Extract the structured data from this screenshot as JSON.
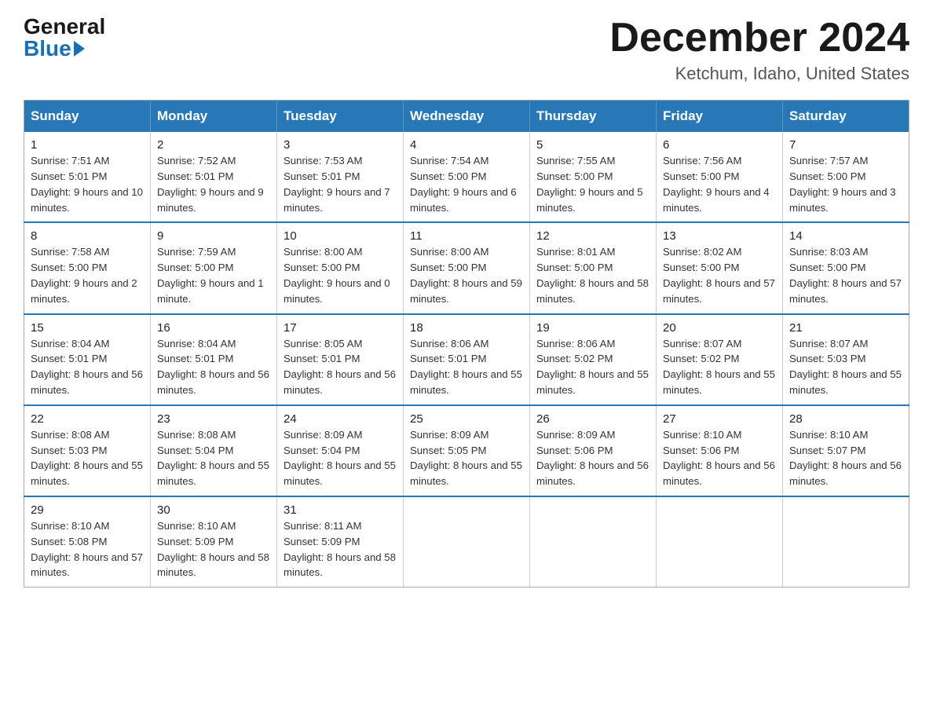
{
  "logo": {
    "general": "General",
    "blue": "Blue"
  },
  "title": "December 2024",
  "subtitle": "Ketchum, Idaho, United States",
  "days_of_week": [
    "Sunday",
    "Monday",
    "Tuesday",
    "Wednesday",
    "Thursday",
    "Friday",
    "Saturday"
  ],
  "weeks": [
    [
      {
        "day": "1",
        "sunrise": "7:51 AM",
        "sunset": "5:01 PM",
        "daylight": "9 hours and 10 minutes."
      },
      {
        "day": "2",
        "sunrise": "7:52 AM",
        "sunset": "5:01 PM",
        "daylight": "9 hours and 9 minutes."
      },
      {
        "day": "3",
        "sunrise": "7:53 AM",
        "sunset": "5:01 PM",
        "daylight": "9 hours and 7 minutes."
      },
      {
        "day": "4",
        "sunrise": "7:54 AM",
        "sunset": "5:00 PM",
        "daylight": "9 hours and 6 minutes."
      },
      {
        "day": "5",
        "sunrise": "7:55 AM",
        "sunset": "5:00 PM",
        "daylight": "9 hours and 5 minutes."
      },
      {
        "day": "6",
        "sunrise": "7:56 AM",
        "sunset": "5:00 PM",
        "daylight": "9 hours and 4 minutes."
      },
      {
        "day": "7",
        "sunrise": "7:57 AM",
        "sunset": "5:00 PM",
        "daylight": "9 hours and 3 minutes."
      }
    ],
    [
      {
        "day": "8",
        "sunrise": "7:58 AM",
        "sunset": "5:00 PM",
        "daylight": "9 hours and 2 minutes."
      },
      {
        "day": "9",
        "sunrise": "7:59 AM",
        "sunset": "5:00 PM",
        "daylight": "9 hours and 1 minute."
      },
      {
        "day": "10",
        "sunrise": "8:00 AM",
        "sunset": "5:00 PM",
        "daylight": "9 hours and 0 minutes."
      },
      {
        "day": "11",
        "sunrise": "8:00 AM",
        "sunset": "5:00 PM",
        "daylight": "8 hours and 59 minutes."
      },
      {
        "day": "12",
        "sunrise": "8:01 AM",
        "sunset": "5:00 PM",
        "daylight": "8 hours and 58 minutes."
      },
      {
        "day": "13",
        "sunrise": "8:02 AM",
        "sunset": "5:00 PM",
        "daylight": "8 hours and 57 minutes."
      },
      {
        "day": "14",
        "sunrise": "8:03 AM",
        "sunset": "5:00 PM",
        "daylight": "8 hours and 57 minutes."
      }
    ],
    [
      {
        "day": "15",
        "sunrise": "8:04 AM",
        "sunset": "5:01 PM",
        "daylight": "8 hours and 56 minutes."
      },
      {
        "day": "16",
        "sunrise": "8:04 AM",
        "sunset": "5:01 PM",
        "daylight": "8 hours and 56 minutes."
      },
      {
        "day": "17",
        "sunrise": "8:05 AM",
        "sunset": "5:01 PM",
        "daylight": "8 hours and 56 minutes."
      },
      {
        "day": "18",
        "sunrise": "8:06 AM",
        "sunset": "5:01 PM",
        "daylight": "8 hours and 55 minutes."
      },
      {
        "day": "19",
        "sunrise": "8:06 AM",
        "sunset": "5:02 PM",
        "daylight": "8 hours and 55 minutes."
      },
      {
        "day": "20",
        "sunrise": "8:07 AM",
        "sunset": "5:02 PM",
        "daylight": "8 hours and 55 minutes."
      },
      {
        "day": "21",
        "sunrise": "8:07 AM",
        "sunset": "5:03 PM",
        "daylight": "8 hours and 55 minutes."
      }
    ],
    [
      {
        "day": "22",
        "sunrise": "8:08 AM",
        "sunset": "5:03 PM",
        "daylight": "8 hours and 55 minutes."
      },
      {
        "day": "23",
        "sunrise": "8:08 AM",
        "sunset": "5:04 PM",
        "daylight": "8 hours and 55 minutes."
      },
      {
        "day": "24",
        "sunrise": "8:09 AM",
        "sunset": "5:04 PM",
        "daylight": "8 hours and 55 minutes."
      },
      {
        "day": "25",
        "sunrise": "8:09 AM",
        "sunset": "5:05 PM",
        "daylight": "8 hours and 55 minutes."
      },
      {
        "day": "26",
        "sunrise": "8:09 AM",
        "sunset": "5:06 PM",
        "daylight": "8 hours and 56 minutes."
      },
      {
        "day": "27",
        "sunrise": "8:10 AM",
        "sunset": "5:06 PM",
        "daylight": "8 hours and 56 minutes."
      },
      {
        "day": "28",
        "sunrise": "8:10 AM",
        "sunset": "5:07 PM",
        "daylight": "8 hours and 56 minutes."
      }
    ],
    [
      {
        "day": "29",
        "sunrise": "8:10 AM",
        "sunset": "5:08 PM",
        "daylight": "8 hours and 57 minutes."
      },
      {
        "day": "30",
        "sunrise": "8:10 AM",
        "sunset": "5:09 PM",
        "daylight": "8 hours and 58 minutes."
      },
      {
        "day": "31",
        "sunrise": "8:11 AM",
        "sunset": "5:09 PM",
        "daylight": "8 hours and 58 minutes."
      },
      null,
      null,
      null,
      null
    ]
  ],
  "labels": {
    "sunrise": "Sunrise:",
    "sunset": "Sunset:",
    "daylight": "Daylight:"
  }
}
